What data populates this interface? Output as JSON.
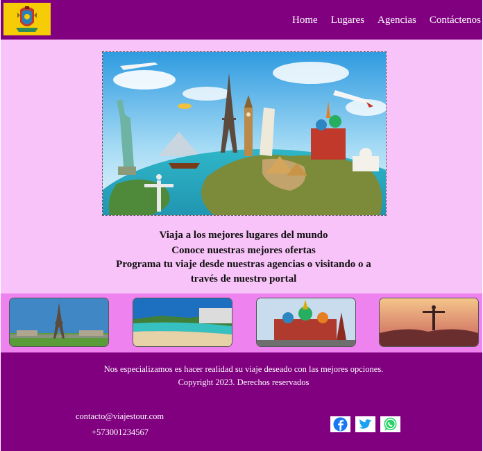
{
  "nav": {
    "items": [
      "Home",
      "Lugares",
      "Agencias",
      "Contáctenos"
    ]
  },
  "intro": {
    "line1": "Viaja a los mejores lugares del mundo",
    "line2": "Conoce nuestras mejores ofertas",
    "line3": "Programa tu viaje desde nuestras agencias o visitando o a través de nuestro portal"
  },
  "footer": {
    "tagline": "Nos especializamos es hacer realidad su viaje deseado con las mejores opciones.",
    "copyright": "Copyright 2023. Derechos reservados",
    "email": "contacto@viajestour.com",
    "phone": "+573001234567"
  },
  "social": [
    "facebook-icon",
    "twitter-icon",
    "whatsapp-icon"
  ],
  "colors": {
    "header": "#800080",
    "background": "#f8c3f8",
    "gallery": "#ee82ee",
    "logo_bg": "#f5cc05"
  }
}
